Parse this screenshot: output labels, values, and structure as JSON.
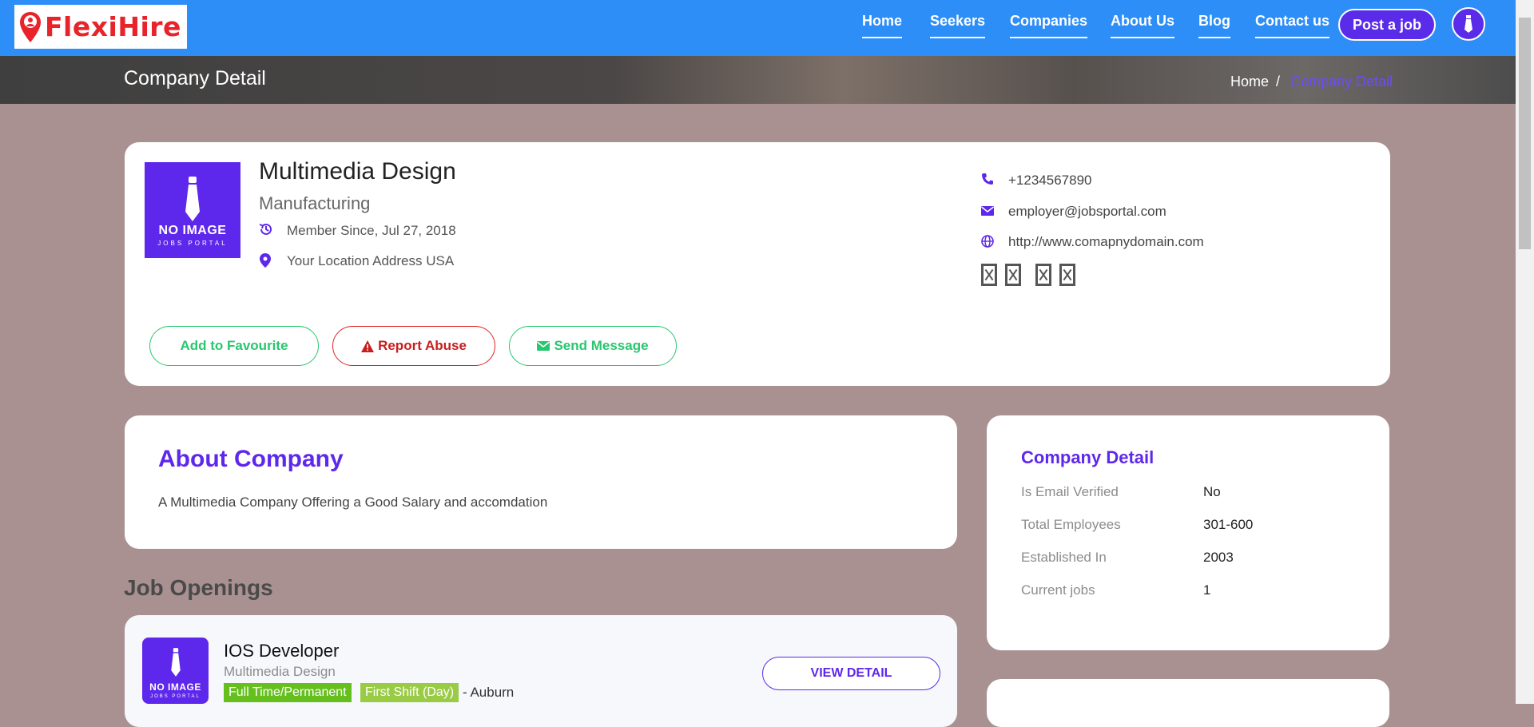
{
  "header": {
    "logo_text": "FlexiHire",
    "nav": [
      "Home",
      "Seekers",
      "Companies",
      "About Us",
      "Blog",
      "Contact us"
    ],
    "post_job": "Post a job",
    "avatar_icon": "no-image-avatar-icon"
  },
  "banner": {
    "title": "Company Detail",
    "breadcrumb_home": "Home",
    "breadcrumb_sep": "/",
    "breadcrumb_current": "Company Detail"
  },
  "company": {
    "name": "Multimedia Design",
    "industry": "Manufacturing",
    "member_since": "Member Since, Jul 27, 2018",
    "location": "Your Location Address USA",
    "phone": "+1234567890",
    "email": "employer@jobsportal.com",
    "website": "http://www.comapnydomain.com",
    "logo_title": "NO IMAGE",
    "logo_sub": "JOBS PORTAL",
    "actions": {
      "favourite": "Add to Favourite",
      "report": "Report Abuse",
      "message": "Send Message"
    }
  },
  "about": {
    "heading": "About Company",
    "text": "A Multimedia Company Offering a Good Salary and accomdation"
  },
  "details": {
    "heading": "Company Detail",
    "rows": [
      {
        "label": "Is Email Verified",
        "value": "No"
      },
      {
        "label": "Total Employees",
        "value": "301-600"
      },
      {
        "label": "Established In",
        "value": "2003"
      },
      {
        "label": "Current jobs",
        "value": "1"
      }
    ]
  },
  "jobs": {
    "heading": "Job Openings",
    "items": [
      {
        "title": "IOS Developer",
        "company": "Multimedia Design",
        "type": "Full Time/Permanent",
        "shift": "First Shift (Day)",
        "location": "- Auburn",
        "button": "VIEW DETAIL",
        "logo_title": "NO IMAGE",
        "logo_sub": "JOBS PORTAL"
      }
    ]
  },
  "colors": {
    "nav_blue": "#2d8ef7",
    "accent_purple": "#5e27ec",
    "green": "#28c76f",
    "red": "#e02424",
    "page_bg": "#a99191"
  }
}
